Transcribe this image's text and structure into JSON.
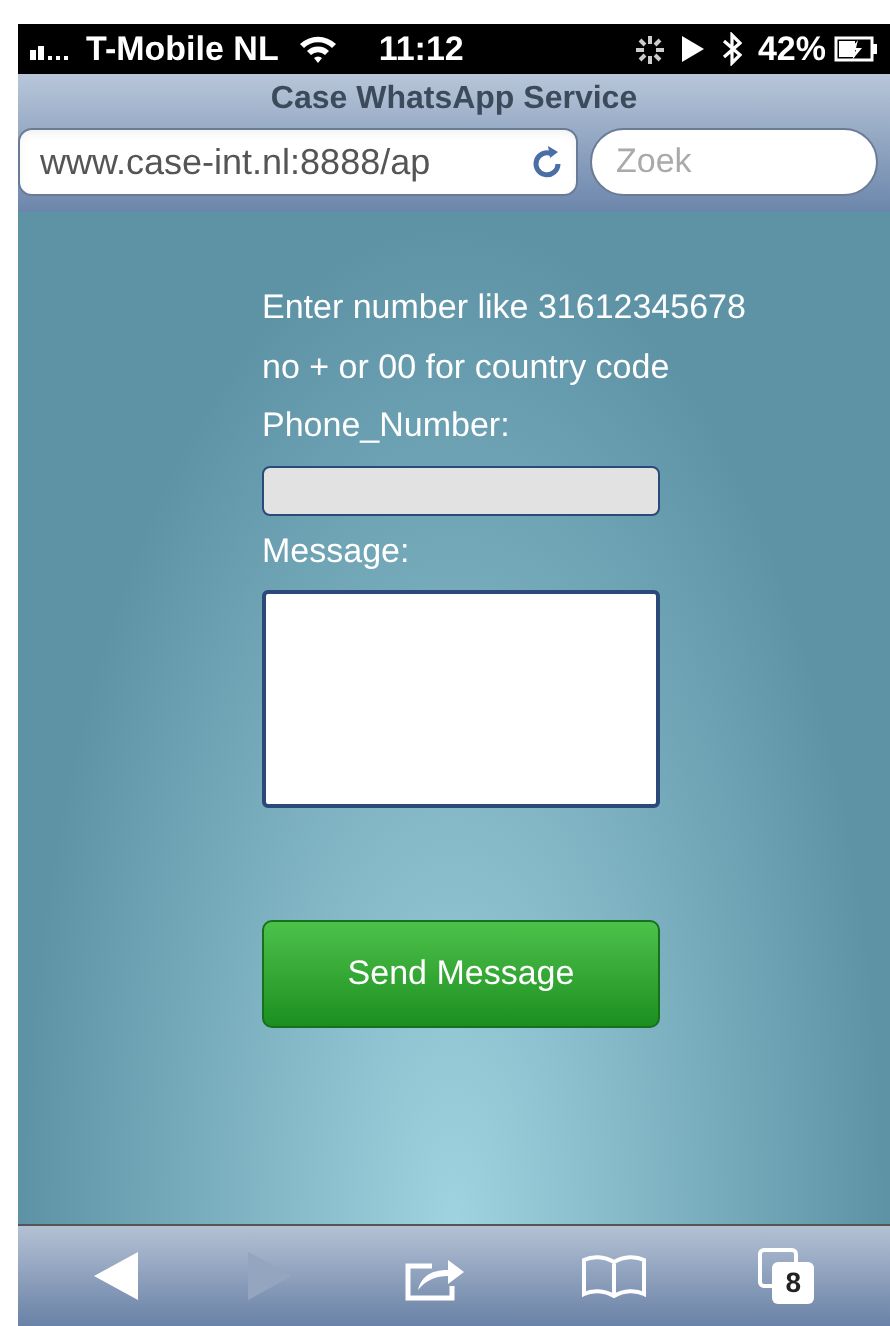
{
  "status_bar": {
    "carrier": "T-Mobile NL",
    "time": "11:12",
    "battery": "42%"
  },
  "browser": {
    "title": "Case WhatsApp Service",
    "url": "www.case-int.nl:8888/ap",
    "search": {
      "placeholder": "Zoek"
    }
  },
  "form": {
    "instructions": [
      "Enter number like 31612345678",
      "no + or 00 for country code"
    ],
    "phone_label": "Phone_Number:",
    "message_label": "Message:",
    "submit": "Send Message"
  },
  "toolbar": {
    "back": {
      "disabled": false
    },
    "forward": {
      "disabled": true
    },
    "tabs_count": "8"
  }
}
